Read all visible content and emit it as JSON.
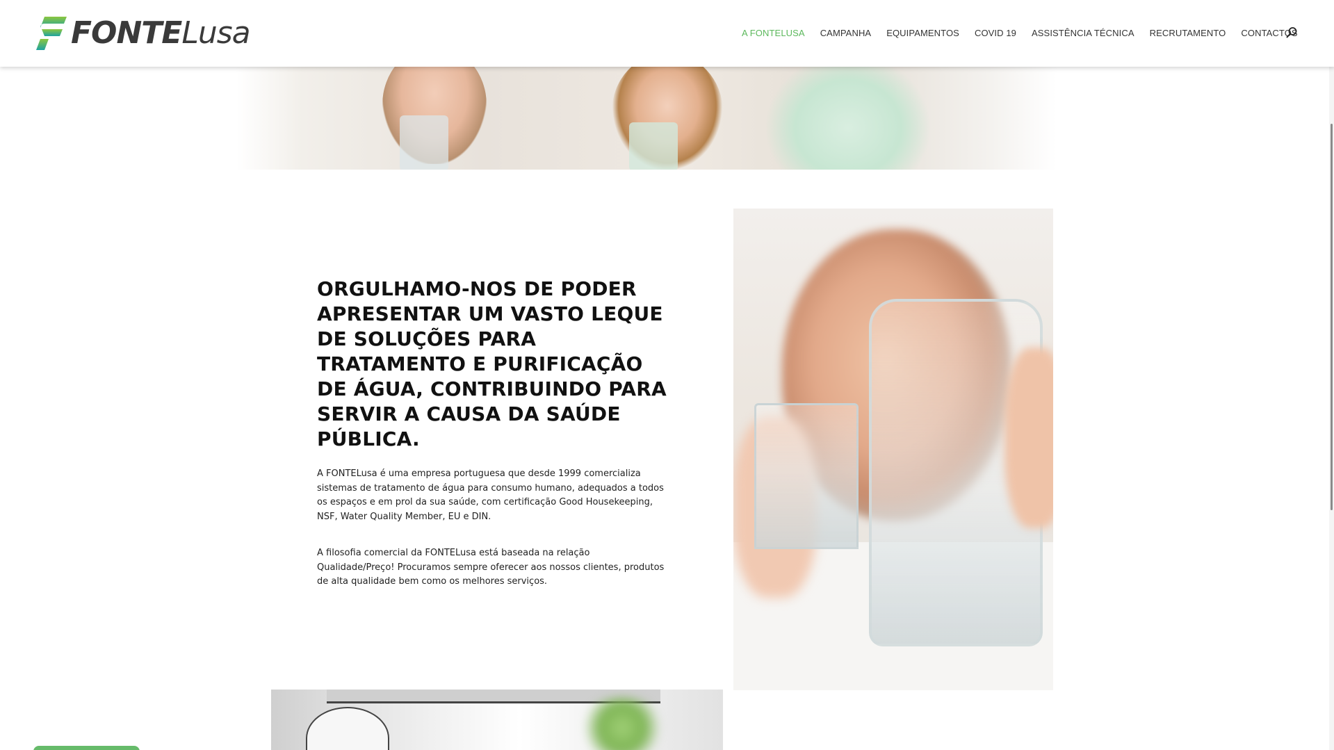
{
  "header": {
    "logo": {
      "text_bold": "FONTE",
      "text_light": "Lusa",
      "icon": "fontelusa-leaf-logo"
    },
    "nav": [
      {
        "label": "A FONTELUSA",
        "active": true
      },
      {
        "label": "CAMPANHA",
        "active": false
      },
      {
        "label": "EQUIPAMENTOS",
        "active": false
      },
      {
        "label": "COVID 19",
        "active": false
      },
      {
        "label": "ASSISTÊNCIA TÉCNICA",
        "active": false
      },
      {
        "label": "RECRUTAMENTO",
        "active": false
      },
      {
        "label": "CONTACTOS",
        "active": false
      }
    ],
    "search_icon": "search-icon"
  },
  "colors": {
    "accent": "#5cb85c",
    "logo_gradient_top": "#8cc63f",
    "logo_gradient_bottom": "#1fa3a0",
    "text": "#111111"
  },
  "content": {
    "headline": {
      "part1": "ORGULHAMO-NOS DE PODER APRESENTAR UM VASTO LEQUE DE SOLUÇÕES PARA ",
      "bold1": "TRATAMENTO E PURIFICAÇÃO DE ÁGUA",
      "part2": ", CONTRIBUINDO PARA SERVIR A CAUSA DA ",
      "bold2": "SAÚDE PÚBLICA",
      "part3": "."
    },
    "paragraph1": "A FONTELusa é uma empresa portuguesa que desde 1999 comercializa sistemas de tratamento de água para consumo humano, adequados a todos os espaços e em prol da sua saúde, com certificação Good Housekeeping, NSF, Water Quality Member, EU e DIN.",
    "paragraph2": "A filosofia comercial da FONTELusa está baseada na relação Qualidade/Preço! Procuramos sempre oferecer aos nossos clientes, produtos de alta qualidade bem como os melhores serviços."
  }
}
